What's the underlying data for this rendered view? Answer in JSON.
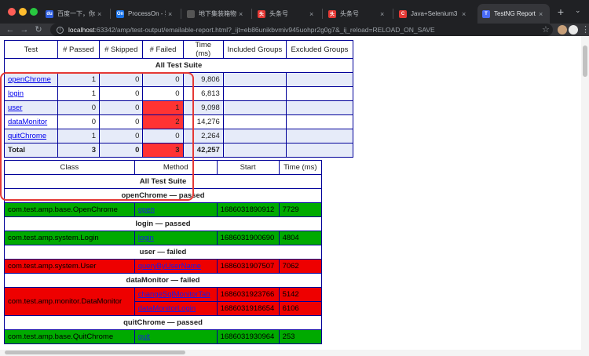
{
  "browser": {
    "tabs": [
      {
        "title": "百度一下，你就知道",
        "icon": "paw-icon",
        "color": "#2f5fe0",
        "glyph": "du"
      },
      {
        "title": "ProcessOn - 我的文件",
        "icon": "on-icon",
        "color": "#1a73e8",
        "glyph": "On"
      },
      {
        "title": "地下集装箱物流系统",
        "icon": "globe-icon",
        "color": "#555555",
        "glyph": ""
      },
      {
        "title": "头条号",
        "icon": "toutiao-icon",
        "color": "#e53935",
        "glyph": "头"
      },
      {
        "title": "头条号",
        "icon": "toutiao-icon",
        "color": "#e53935",
        "glyph": "头"
      },
      {
        "title": "Java+Selenium3",
        "icon": "csdn-icon",
        "color": "#e53935",
        "glyph": "C"
      },
      {
        "title": "TestNG Report",
        "icon": "report-icon",
        "color": "#4a6cf7",
        "glyph": "T"
      }
    ],
    "url_host": "localhost",
    "url_rest": ":63342/amp/test-output/emailable-report.html?_ijt=eb86unikbvmiv945uohpr2g0g7&_ij_reload=RELOAD_ON_SAVE"
  },
  "summary": {
    "headers": [
      "Test",
      "# Passed",
      "# Skipped",
      "# Failed",
      "Time (ms)",
      "Included Groups",
      "Excluded Groups"
    ],
    "suite_title": "All Test Suite",
    "rows": [
      {
        "test": "openChrome",
        "passed": "1",
        "skipped": "0",
        "failed": "0",
        "time": "9,806",
        "failed_flag": false
      },
      {
        "test": "login",
        "passed": "1",
        "skipped": "0",
        "failed": "0",
        "time": "6,813",
        "failed_flag": false
      },
      {
        "test": "user",
        "passed": "0",
        "skipped": "0",
        "failed": "1",
        "time": "9,098",
        "failed_flag": true
      },
      {
        "test": "dataMonitor",
        "passed": "0",
        "skipped": "0",
        "failed": "2",
        "time": "14,276",
        "failed_flag": true
      },
      {
        "test": "quitChrome",
        "passed": "1",
        "skipped": "0",
        "failed": "0",
        "time": "2,264",
        "failed_flag": false
      }
    ],
    "total": {
      "label": "Total",
      "passed": "3",
      "skipped": "0",
      "failed": "3",
      "time": "42,257"
    }
  },
  "detail": {
    "headers": [
      "Class",
      "Method",
      "Start",
      "Time (ms)"
    ],
    "suite_title": "All Test Suite",
    "groups": [
      {
        "title": "openChrome — passed",
        "status": "pass",
        "rows": [
          {
            "class": "com.test.amp.base.OpenChrome",
            "method": "open",
            "start": "1686031890912",
            "time": "7729"
          }
        ]
      },
      {
        "title": "login — passed",
        "status": "pass",
        "rows": [
          {
            "class": "com.test.amp.system.Login",
            "method": "login",
            "start": "1686031900690",
            "time": "4804"
          }
        ]
      },
      {
        "title": "user — failed",
        "status": "fail",
        "rows": [
          {
            "class": "com.test.amp.system.User",
            "method": "queryByUserName",
            "start": "1686031907507",
            "time": "7062"
          }
        ]
      },
      {
        "title": "dataMonitor — failed",
        "status": "fail",
        "rows": [
          {
            "class": "com.test.amp.monitor.DataMonitor",
            "method": "changeSqlMonitorTab",
            "start": "1686031923766",
            "time": "5142"
          },
          {
            "class": "",
            "method": "dataMonitorLogin",
            "start": "1686031918654",
            "time": "6106"
          }
        ]
      },
      {
        "title": "quitChrome — passed",
        "status": "pass",
        "rows": [
          {
            "class": "com.test.amp.base.QuitChrome",
            "method": "quit",
            "start": "1686031930964",
            "time": "253"
          }
        ]
      }
    ]
  },
  "colors": {
    "pass": "#00aa00",
    "fail": "#ee0000",
    "highlight": "#e53935",
    "alt_row": "#e6ebf9"
  }
}
